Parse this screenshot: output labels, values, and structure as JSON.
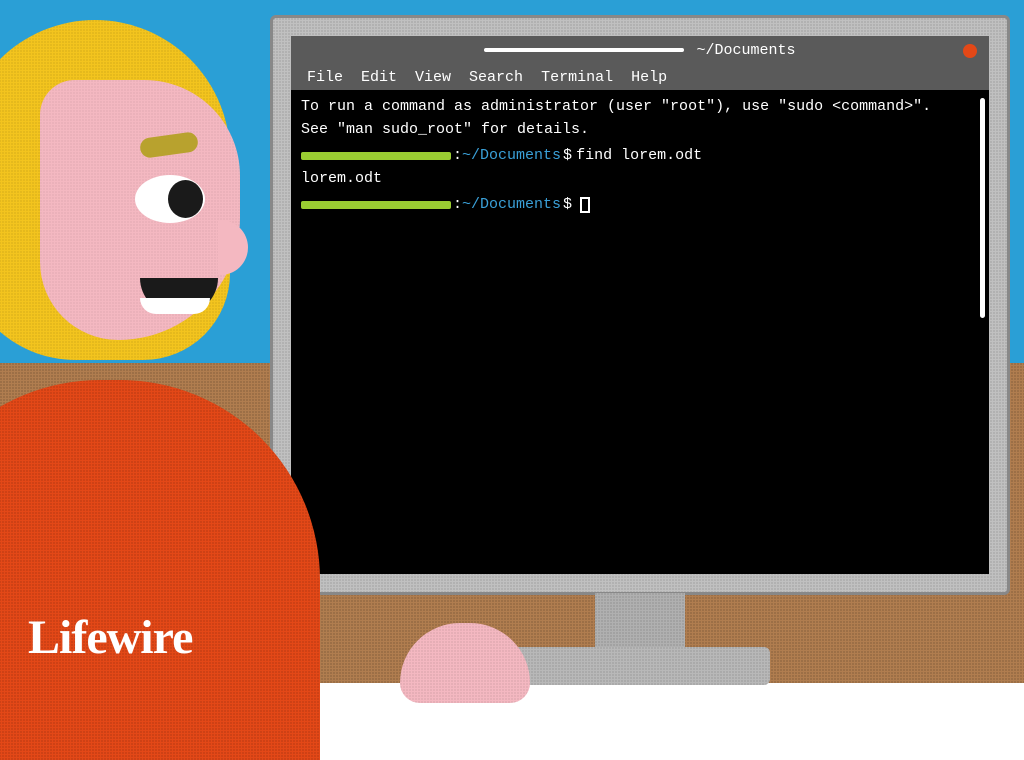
{
  "brand": "Lifewire",
  "titlebar": {
    "path": "~/Documents"
  },
  "menubar": {
    "items": [
      "File",
      "Edit",
      "View",
      "Search",
      "Terminal",
      "Help"
    ]
  },
  "terminal": {
    "motd_line1": "To run a command as administrator (user \"root\"), use \"sudo <command>\".",
    "motd_line2": "See \"man sudo_root\" for details.",
    "prompt1": {
      "colon": ":",
      "path": "~/Documents",
      "dollar": "$",
      "command": "find lorem.odt"
    },
    "output1": "lorem.odt",
    "prompt2": {
      "colon": ":",
      "path": "~/Documents",
      "dollar": "$"
    }
  }
}
